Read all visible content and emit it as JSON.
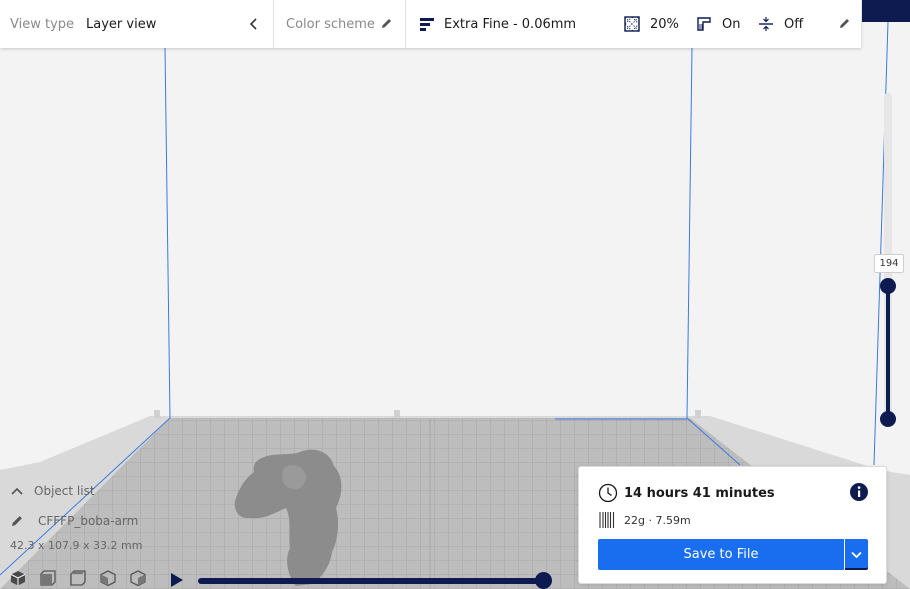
{
  "toolbar": {
    "view_type_label": "View type",
    "view_type_value": "Layer view",
    "color_scheme_label": "Color scheme",
    "profile": "Extra Fine - 0.06mm",
    "infill": "20%",
    "support": "On",
    "adhesion": "Off",
    "icons": {
      "collapse": "chevron-left-icon",
      "edit": "pencil-icon",
      "profile": "profile-bars-icon",
      "infill": "infill-icon",
      "support": "support-icon",
      "adhesion": "adhesion-icon"
    }
  },
  "layer_slider": {
    "current_layer": "194"
  },
  "object_list": {
    "toggle_label": "Object list",
    "object_name": "CFFFP_boba-arm",
    "dimensions": "42.3 x 107.9 x 33.2 mm"
  },
  "camera_views": [
    "3d-view-icon",
    "front-view-icon",
    "top-view-icon",
    "left-view-icon",
    "right-view-icon"
  ],
  "simulation": {
    "progress": 1.0,
    "play_icon": "play-icon"
  },
  "print_info": {
    "time": "14 hours 41 minutes",
    "material": "22g · 7.59m",
    "save_label": "Save to File",
    "icons": {
      "time": "clock-icon",
      "info": "info-icon",
      "material": "filament-spool-icon",
      "dropdown": "chevron-down-icon"
    }
  },
  "colors": {
    "accent": "#196ef0",
    "dark": "#0d1b50",
    "build_volume_line": "#3b7be0",
    "build_plate": "#bdbdbd",
    "model": "#8c8c8c"
  }
}
